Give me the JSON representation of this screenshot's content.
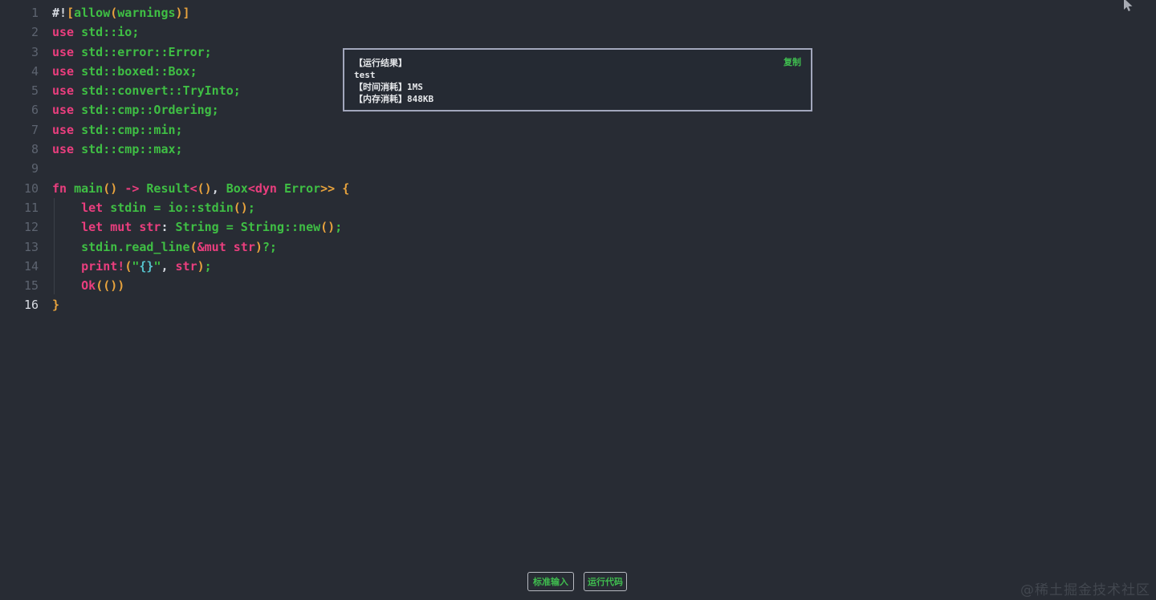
{
  "colors": {
    "background": "#282c34",
    "keyword_pink": "#ea3e7e",
    "code_green": "#3fbf44",
    "orange": "#e8a33d",
    "cyan": "#56c2cc",
    "plain": "#d5d9e0",
    "line_number": "#5d6470",
    "line_number_active": "#d8dbe2",
    "indent_guide": "#3b4048",
    "popup_border": "#a2a7bc",
    "popup_text": "#e6e8eb",
    "accent_green": "#3fbd4f",
    "button_border": "#b7bac1",
    "watermark": "#42474f",
    "cursor_icon": "#a7abb3"
  },
  "editor": {
    "language": "rust",
    "lines": [
      {
        "num": "1",
        "tokens": [
          {
            "t": "#!",
            "c": "w"
          },
          {
            "t": "[",
            "c": "o"
          },
          {
            "t": "allow",
            "c": "g"
          },
          {
            "t": "(",
            "c": "o"
          },
          {
            "t": "warnings",
            "c": "g"
          },
          {
            "t": ")]",
            "c": "o"
          }
        ]
      },
      {
        "num": "2",
        "tokens": [
          {
            "t": "use ",
            "c": "k"
          },
          {
            "t": "std::io;",
            "c": "g"
          }
        ]
      },
      {
        "num": "3",
        "tokens": [
          {
            "t": "use ",
            "c": "k"
          },
          {
            "t": "std::error::Error;",
            "c": "g"
          }
        ]
      },
      {
        "num": "4",
        "tokens": [
          {
            "t": "use ",
            "c": "k"
          },
          {
            "t": "std::boxed::Box;",
            "c": "g"
          }
        ]
      },
      {
        "num": "5",
        "tokens": [
          {
            "t": "use ",
            "c": "k"
          },
          {
            "t": "std::convert::TryInto;",
            "c": "g"
          }
        ]
      },
      {
        "num": "6",
        "tokens": [
          {
            "t": "use ",
            "c": "k"
          },
          {
            "t": "std::cmp::Ordering;",
            "c": "g"
          }
        ]
      },
      {
        "num": "7",
        "tokens": [
          {
            "t": "use ",
            "c": "k"
          },
          {
            "t": "std::cmp::min;",
            "c": "g"
          }
        ]
      },
      {
        "num": "8",
        "tokens": [
          {
            "t": "use ",
            "c": "k"
          },
          {
            "t": "std::cmp::max;",
            "c": "g"
          }
        ]
      },
      {
        "num": "9",
        "tokens": []
      },
      {
        "num": "10",
        "tokens": [
          {
            "t": "fn ",
            "c": "k"
          },
          {
            "t": "main",
            "c": "g"
          },
          {
            "t": "()",
            "c": "o"
          },
          {
            "t": " ",
            "c": "w"
          },
          {
            "t": "->",
            "c": "k"
          },
          {
            "t": " ",
            "c": "w"
          },
          {
            "t": "Result",
            "c": "g"
          },
          {
            "t": "<",
            "c": "k"
          },
          {
            "t": "()",
            "c": "o"
          },
          {
            "t": ", ",
            "c": "w"
          },
          {
            "t": "Box",
            "c": "g"
          },
          {
            "t": "<",
            "c": "k"
          },
          {
            "t": "dyn ",
            "c": "k"
          },
          {
            "t": "Error",
            "c": "g"
          },
          {
            "t": ">>",
            "c": "o"
          },
          {
            "t": " ",
            "c": "w"
          },
          {
            "t": "{",
            "c": "o"
          }
        ]
      },
      {
        "num": "11",
        "tokens": [
          {
            "t": "    ",
            "c": "w"
          },
          {
            "t": "let ",
            "c": "k"
          },
          {
            "t": "stdin = io::stdin",
            "c": "g"
          },
          {
            "t": "()",
            "c": "o"
          },
          {
            "t": ";",
            "c": "g"
          }
        ]
      },
      {
        "num": "12",
        "tokens": [
          {
            "t": "    ",
            "c": "w"
          },
          {
            "t": "let ",
            "c": "k"
          },
          {
            "t": "mut ",
            "c": "k"
          },
          {
            "t": "str",
            "c": "k"
          },
          {
            "t": ": ",
            "c": "w"
          },
          {
            "t": "String = String::new",
            "c": "g"
          },
          {
            "t": "()",
            "c": "o"
          },
          {
            "t": ";",
            "c": "g"
          }
        ]
      },
      {
        "num": "13",
        "tokens": [
          {
            "t": "    ",
            "c": "w"
          },
          {
            "t": "stdin.read_line",
            "c": "g"
          },
          {
            "t": "(",
            "c": "o"
          },
          {
            "t": "&mut str",
            "c": "k"
          },
          {
            "t": ")",
            "c": "o"
          },
          {
            "t": "?;",
            "c": "g"
          }
        ]
      },
      {
        "num": "14",
        "tokens": [
          {
            "t": "    ",
            "c": "w"
          },
          {
            "t": "print!",
            "c": "k"
          },
          {
            "t": "(",
            "c": "o"
          },
          {
            "t": "\"",
            "c": "g"
          },
          {
            "t": "{}",
            "c": "c"
          },
          {
            "t": "\"",
            "c": "g"
          },
          {
            "t": ", ",
            "c": "w"
          },
          {
            "t": "str",
            "c": "k"
          },
          {
            "t": ")",
            "c": "o"
          },
          {
            "t": ";",
            "c": "g"
          }
        ]
      },
      {
        "num": "15",
        "tokens": [
          {
            "t": "    ",
            "c": "w"
          },
          {
            "t": "Ok",
            "c": "k"
          },
          {
            "t": "(())",
            "c": "o"
          }
        ]
      },
      {
        "num": "16",
        "active": true,
        "tokens": [
          {
            "t": "}",
            "c": "o"
          }
        ]
      }
    ]
  },
  "popup": {
    "lines": [
      "【运行结果】",
      "test",
      "【时间消耗】1MS",
      "【内存消耗】848KB"
    ],
    "copy_label": "复制"
  },
  "footer": {
    "buttons": [
      {
        "label": "标准输入"
      },
      {
        "label": "运行代码"
      }
    ]
  },
  "watermark": "@稀土掘金技术社区",
  "icons": {
    "top_right": "mouse-cursor-icon"
  }
}
